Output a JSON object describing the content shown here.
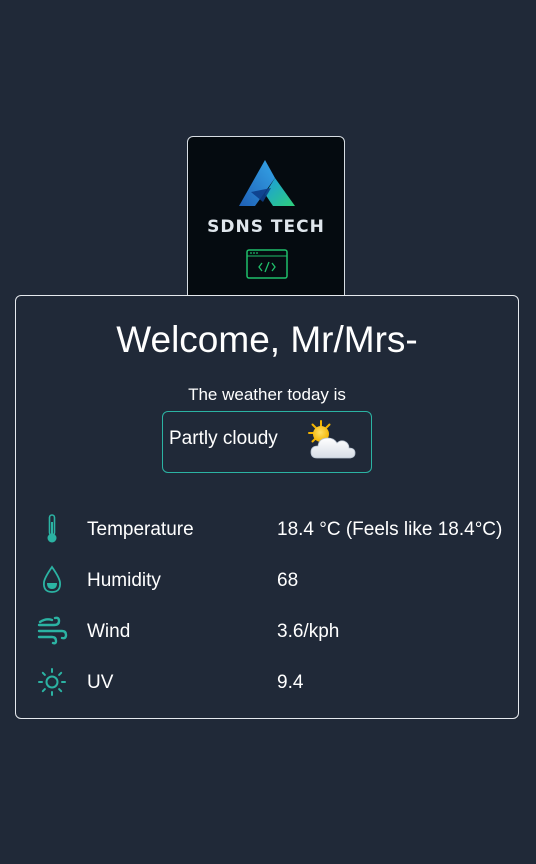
{
  "logo": {
    "brand_text": "SDNS TECH"
  },
  "greeting": {
    "title": "Welcome, Mr/Mrs-"
  },
  "weather": {
    "intro": "The weather today is",
    "condition": "Partly cloudy",
    "condition_icon": "partly-cloudy-icon",
    "accent_color": "#2bb3a3"
  },
  "stats": [
    {
      "icon": "thermometer-icon",
      "label": "Temperature",
      "value": "18.4 °C (Feels like 18.4°C)"
    },
    {
      "icon": "droplet-icon",
      "label": "Humidity",
      "value": "68"
    },
    {
      "icon": "wind-icon",
      "label": "Wind",
      "value": "3.6/kph"
    },
    {
      "icon": "sun-icon",
      "label": "UV",
      "value": "9.4"
    }
  ],
  "colors": {
    "background": "#202938",
    "icon_teal": "#2bb3a3"
  }
}
